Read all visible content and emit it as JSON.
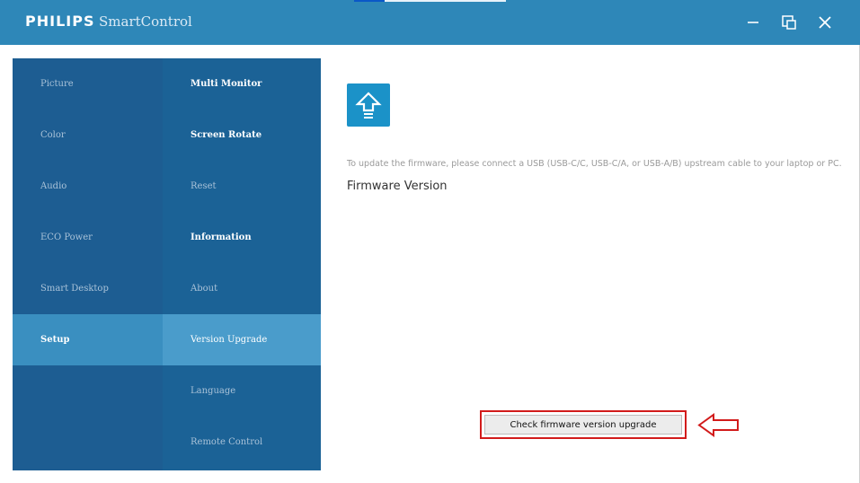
{
  "titlebar": {
    "brand": "PHILIPS",
    "app_name": "SmartControl"
  },
  "menu": {
    "primary": [
      "Picture",
      "Color",
      "Audio",
      "ECO Power",
      "Smart Desktop",
      "Setup"
    ],
    "primary_active": "Setup",
    "secondary": [
      {
        "label": "Multi Monitor",
        "style": "strong"
      },
      {
        "label": "Screen Rotate",
        "style": "strong"
      },
      {
        "label": "Reset",
        "style": "normal"
      },
      {
        "label": "Information",
        "style": "strong"
      },
      {
        "label": "About",
        "style": "normal"
      },
      {
        "label": "Version Upgrade",
        "style": "active"
      },
      {
        "label": "Language",
        "style": "normal"
      },
      {
        "label": "Remote Control",
        "style": "normal"
      }
    ]
  },
  "content": {
    "icon": "upload-arrow-icon",
    "info_text": "To update the firmware, please connect a USB (USB-C/C, USB-C/A, or USB-A/B) upstream cable to your laptop or PC.",
    "firmware_title": "Firmware Version",
    "check_button_label": "Check firmware version upgrade"
  },
  "colors": {
    "titlebar": "#2e87b8",
    "panel": "#1d5d92",
    "active": "#3a8fc0",
    "highlight_box": "#d21b1b"
  }
}
